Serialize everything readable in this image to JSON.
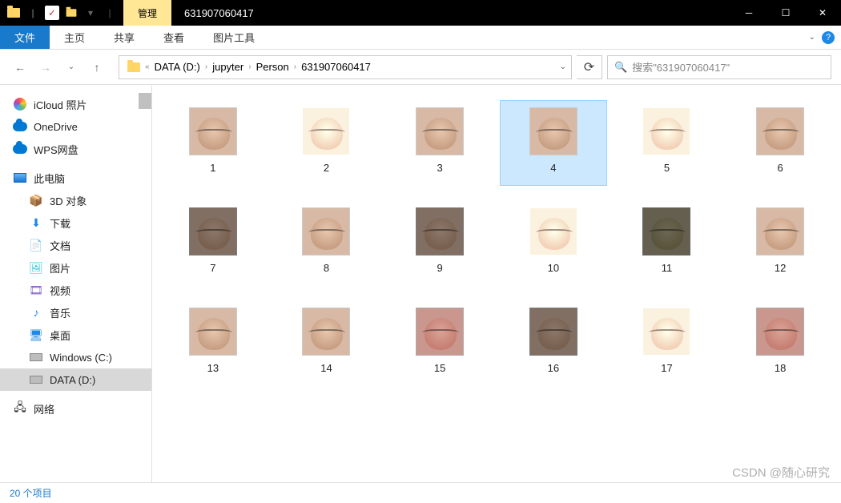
{
  "titlebar": {
    "manage_tab": "管理",
    "window_title": "631907060417"
  },
  "ribbon": {
    "file": "文件",
    "home": "主页",
    "share": "共享",
    "view": "查看",
    "picture_tools": "图片工具"
  },
  "breadcrumb": {
    "segments": [
      "DATA (D:)",
      "jupyter",
      "Person",
      "631907060417"
    ]
  },
  "search": {
    "placeholder": "搜索\"631907060417\""
  },
  "sidebar": {
    "quick": [
      {
        "label": "iCloud 照片",
        "icon": "icloud"
      },
      {
        "label": "OneDrive",
        "icon": "cloud"
      },
      {
        "label": "WPS网盘",
        "icon": "cloud"
      }
    ],
    "this_pc": "此电脑",
    "pc_items": [
      {
        "label": "3D 对象",
        "icon": "📦"
      },
      {
        "label": "下载",
        "icon": "⬇"
      },
      {
        "label": "文档",
        "icon": "📄"
      },
      {
        "label": "图片",
        "icon": "🖼"
      },
      {
        "label": "视频",
        "icon": "🎞"
      },
      {
        "label": "音乐",
        "icon": "♪"
      },
      {
        "label": "桌面",
        "icon": "🖥"
      }
    ],
    "drives": [
      {
        "label": "Windows (C:)",
        "selected": false
      },
      {
        "label": "DATA (D:)",
        "selected": true
      }
    ],
    "network": "网络"
  },
  "files": [
    {
      "name": "1",
      "tone": ""
    },
    {
      "name": "2",
      "tone": "bright"
    },
    {
      "name": "3",
      "tone": ""
    },
    {
      "name": "4",
      "tone": "",
      "selected": true
    },
    {
      "name": "5",
      "tone": "bright"
    },
    {
      "name": "6",
      "tone": ""
    },
    {
      "name": "7",
      "tone": "dark"
    },
    {
      "name": "8",
      "tone": ""
    },
    {
      "name": "9",
      "tone": "dark"
    },
    {
      "name": "10",
      "tone": "bright"
    },
    {
      "name": "11",
      "tone": "purple"
    },
    {
      "name": "12",
      "tone": ""
    },
    {
      "name": "13",
      "tone": ""
    },
    {
      "name": "14",
      "tone": ""
    },
    {
      "name": "15",
      "tone": "redish"
    },
    {
      "name": "16",
      "tone": "dark"
    },
    {
      "name": "17",
      "tone": "bright"
    },
    {
      "name": "18",
      "tone": "redish"
    }
  ],
  "status": {
    "item_count": "20 个项目"
  },
  "watermark": "CSDN @随心研究"
}
